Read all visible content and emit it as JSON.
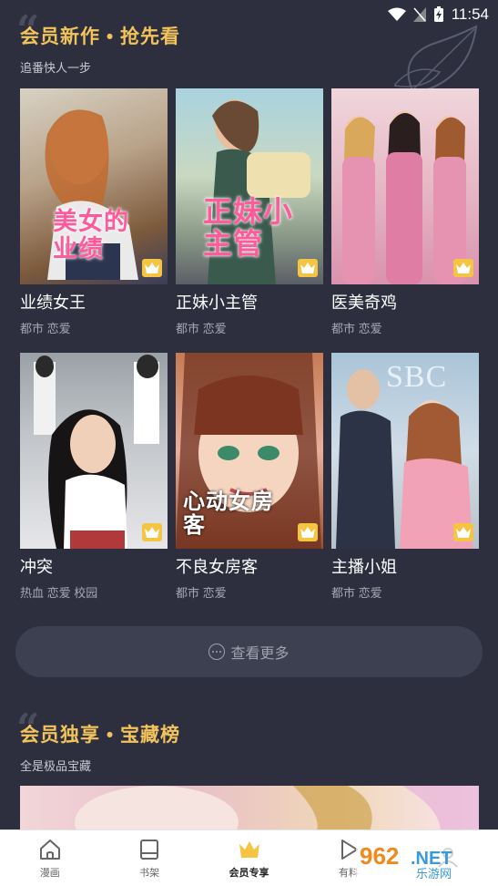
{
  "status_bar": {
    "time": "11:54"
  },
  "section1": {
    "title": "会员新作 • 抢先看",
    "subtitle": "追番快人一步",
    "items": [
      {
        "title": "业绩女王",
        "tags": "都市 恋爱",
        "cover_text": "美女的业绩"
      },
      {
        "title": "正妹小主管",
        "tags": "都市 恋爱",
        "cover_text": "正妹小主管"
      },
      {
        "title": "医美奇鸡",
        "tags": "都市 恋爱",
        "cover_text": ""
      },
      {
        "title": "冲突",
        "tags": "热血 恋爱 校园",
        "cover_text": ""
      },
      {
        "title": "不良女房客",
        "tags": "都市 恋爱",
        "cover_text": "心动女房客"
      },
      {
        "title": "主播小姐",
        "tags": "都市 恋爱",
        "cover_text": "SBC"
      }
    ]
  },
  "more_button": {
    "label": "查看更多"
  },
  "section2": {
    "title": "会员独享 • 宝藏榜",
    "subtitle": "全是极品宝藏"
  },
  "tabbar": {
    "tabs": [
      {
        "label": "漫画",
        "icon": "home-icon"
      },
      {
        "label": "书架",
        "icon": "bookshelf-icon"
      },
      {
        "label": "会员专享",
        "icon": "crown-icon"
      },
      {
        "label": "有料",
        "icon": "play-icon"
      },
      {
        "label": "",
        "icon": "profile-icon"
      }
    ]
  },
  "watermark": {
    "text": "962.NET",
    "subtext": "乐游网"
  },
  "colors": {
    "background": "#2d2f3f",
    "accent": "#f2c35b",
    "tab_active": "#f5c442"
  }
}
